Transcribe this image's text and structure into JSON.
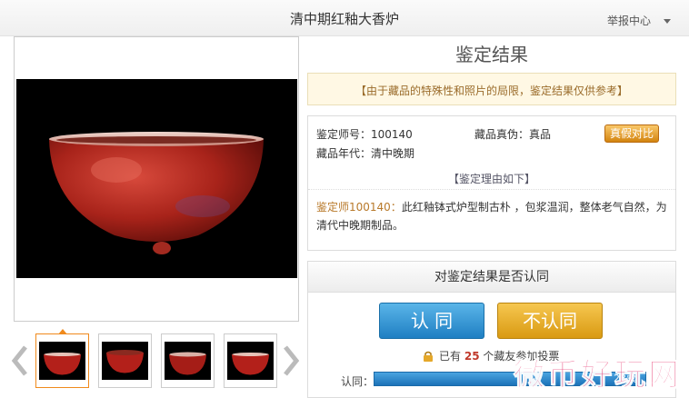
{
  "header": {
    "title": "清中期红釉大香炉",
    "report_label": "举报中心"
  },
  "thumbnails": {
    "count": 4,
    "active_index": 0
  },
  "result": {
    "title": "鉴定结果",
    "notice": "【由于藏品的特殊性和照片的局限，鉴定结果仅供参考】",
    "appraiser_id": "鉴定师号：100140",
    "authenticity": "藏品真伪：真品",
    "era": "藏品年代：清中晚期",
    "compare_button": "真假对比",
    "reason_heading": "【鉴定理由如下】",
    "reason_author": "鉴定师100140：",
    "reason_text": "此红釉钵式炉型制古朴 ，包浆温润，整体老气自然，为清代中晚期制品。"
  },
  "vote": {
    "heading": "对鉴定结果是否认同",
    "agree_button": "认 同",
    "disagree_button": "不认同",
    "voted_prefix": "已有",
    "voted_count": "25",
    "voted_suffix": "个藏友参加投票",
    "agree_label": "认同：",
    "agree_count": "23票"
  },
  "watermark": "微币好玩网",
  "colors": {
    "accent_blue": "#1f7fc3",
    "accent_gold": "#d99a12",
    "notice_bg": "#fff8e4",
    "thumb_active": "#f08a1c",
    "glaze_red": "#b3201a"
  }
}
